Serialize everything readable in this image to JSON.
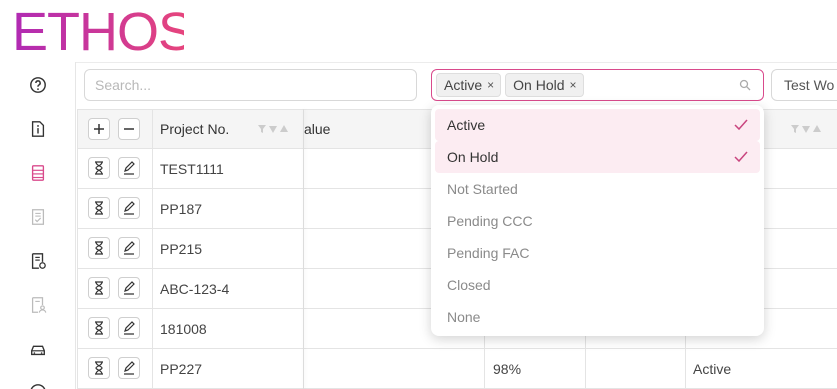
{
  "brand": {
    "logo_text": "ETHOS",
    "gradient": [
      "#b02ab4",
      "#e9467a"
    ]
  },
  "sidebar": {
    "items": [
      {
        "icon": "help-circle-icon"
      },
      {
        "icon": "document-info-icon"
      },
      {
        "icon": "document-list-icon",
        "active": true
      },
      {
        "icon": "document-check-icon"
      },
      {
        "icon": "document-gear-icon"
      },
      {
        "icon": "document-person-icon"
      },
      {
        "icon": "car-icon"
      }
    ]
  },
  "toolbar": {
    "search_placeholder": "Search...",
    "status_filter": {
      "chips": [
        "Active",
        "On Hold"
      ],
      "remove_glyph": "×"
    },
    "secondary_filter_value": "Test Wo"
  },
  "table": {
    "header": {
      "project_no": "Project No.",
      "value_partial": "alue"
    },
    "rows": [
      {
        "project_no": "TEST1111",
        "percent": "",
        "status": ""
      },
      {
        "project_no": "PP187",
        "percent": "",
        "status": ""
      },
      {
        "project_no": "PP215",
        "percent": "",
        "status": ""
      },
      {
        "project_no": "ABC-123-4",
        "percent": "",
        "status": ""
      },
      {
        "project_no": "181008",
        "percent": "",
        "status": ""
      },
      {
        "project_no": "PP227",
        "percent": "98%",
        "status": "Active"
      }
    ]
  },
  "status_dropdown": {
    "options": [
      {
        "label": "Active",
        "selected": true
      },
      {
        "label": "On Hold",
        "selected": true
      },
      {
        "label": "Not Started",
        "selected": false
      },
      {
        "label": "Pending CCC",
        "selected": false
      },
      {
        "label": "Pending FAC",
        "selected": false
      },
      {
        "label": "Closed",
        "selected": false
      },
      {
        "label": "None",
        "selected": false
      }
    ]
  },
  "colors": {
    "accent": "#d94a8c",
    "selected_bg": "#fcecf2",
    "check": "#c9457f"
  }
}
